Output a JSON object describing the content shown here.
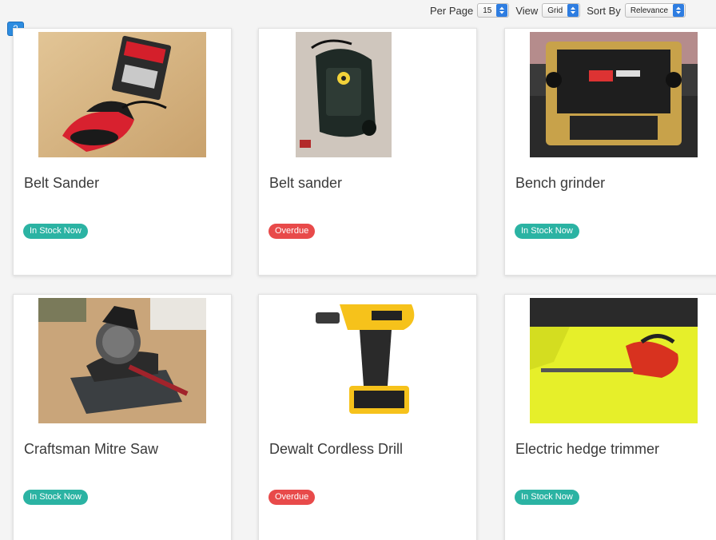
{
  "toolbar": {
    "per_page_label": "Per Page",
    "per_page_value": "15",
    "view_label": "View",
    "view_value": "Grid",
    "sort_label": "Sort By",
    "sort_value": "Relevance"
  },
  "page_badge": "2",
  "colors": {
    "in_stock": "#2bb3a3",
    "overdue": "#e84a4a",
    "select_arrow": "#2e7de1",
    "badge": "#2d8ce0"
  },
  "products": [
    {
      "title": "Belt Sander",
      "status": "In Stock Now",
      "status_type": "in-stock",
      "image": "belt-sander-1"
    },
    {
      "title": "Belt sander",
      "status": "Overdue",
      "status_type": "overdue",
      "image": "belt-sander-2"
    },
    {
      "title": "Bench grinder",
      "status": "In Stock Now",
      "status_type": "in-stock",
      "image": "bench-grinder"
    },
    {
      "title": "Craftsman Mitre Saw",
      "status": "In Stock Now",
      "status_type": "in-stock",
      "image": "mitre-saw"
    },
    {
      "title": "Dewalt Cordless Drill",
      "status": "Overdue",
      "status_type": "overdue",
      "image": "cordless-drill"
    },
    {
      "title": "Electric hedge trimmer",
      "status": "In Stock Now",
      "status_type": "in-stock",
      "image": "hedge-trimmer"
    }
  ]
}
